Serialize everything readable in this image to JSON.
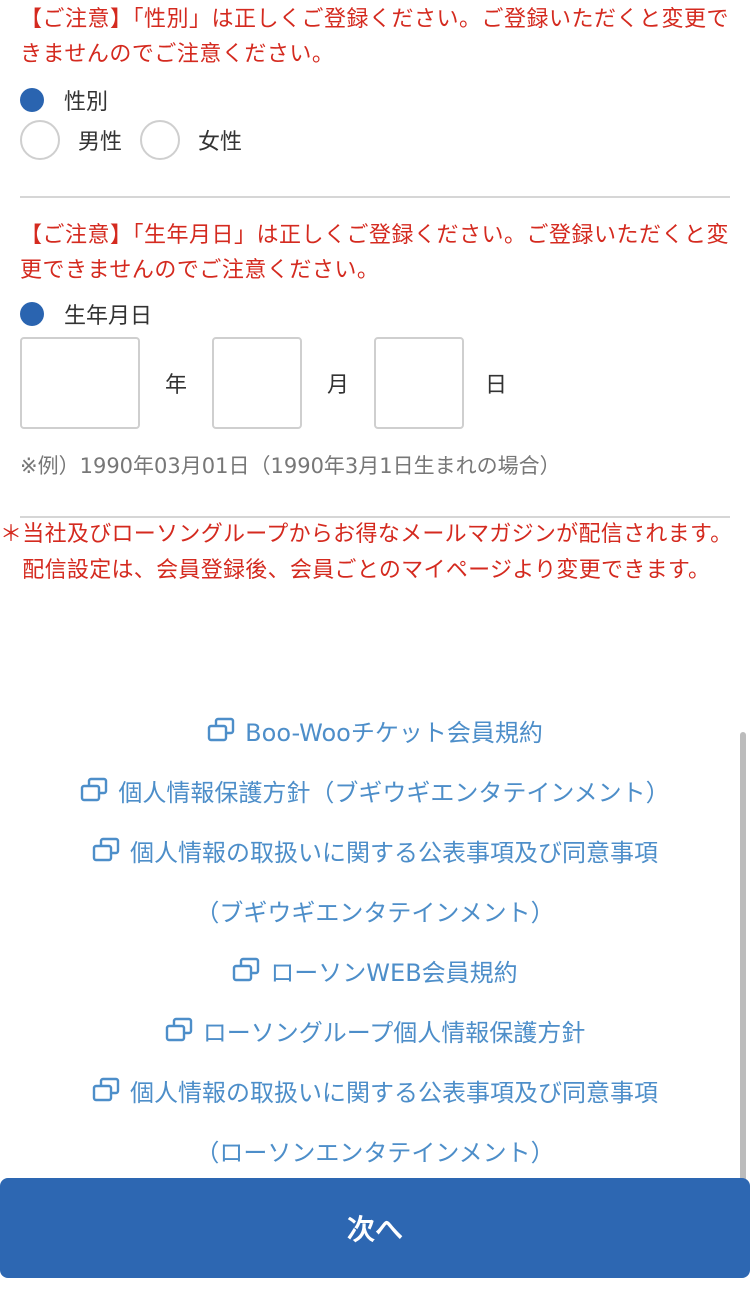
{
  "gender": {
    "notice": "【ご注意】「性別」は正しくご登録ください。ご登録いただくと変更できませんのでご注意ください。",
    "label": "性別",
    "options": [
      "男性",
      "女性"
    ]
  },
  "birthdate": {
    "notice": "【ご注意】「生年月日」は正しくご登録ください。ご登録いただくと変更できませんのでご注意ください。",
    "label": "生年月日",
    "year_unit": "年",
    "month_unit": "月",
    "day_unit": "日",
    "example": "※例）1990年03月01日（1990年3月1日生まれの場合）"
  },
  "mail_notice": {
    "line1": "＊当社及びローソングループからお得なメールマガジンが配信されます。",
    "line2": "　配信設定は、会員登録後、会員ごとのマイページより変更できます。"
  },
  "links": [
    {
      "label": "Boo-Wooチケット会員規約",
      "icon": "external-window-icon"
    },
    {
      "label": "個人情報保護方針（ブギウギエンタテインメント）",
      "icon": "external-window-icon"
    },
    {
      "label": "個人情報の取扱いに関する公表事項及び同意事項",
      "icon": "external-window-icon"
    },
    {
      "label": "（ブギウギエンタテインメント）",
      "icon": ""
    },
    {
      "label": "ローソンWEB会員規約",
      "icon": "external-window-icon"
    },
    {
      "label": "ローソングループ個人情報保護方針",
      "icon": "external-window-icon"
    },
    {
      "label": "個人情報の取扱いに関する公表事項及び同意事項",
      "icon": "external-window-icon"
    },
    {
      "label": "（ローソンエンタテインメント）",
      "icon": ""
    }
  ],
  "next_button": {
    "label": "次へ"
  },
  "colors": {
    "notice_red": "#d42a1f",
    "accent_blue": "#2d67b2",
    "link_blue": "#4d8ec9"
  }
}
